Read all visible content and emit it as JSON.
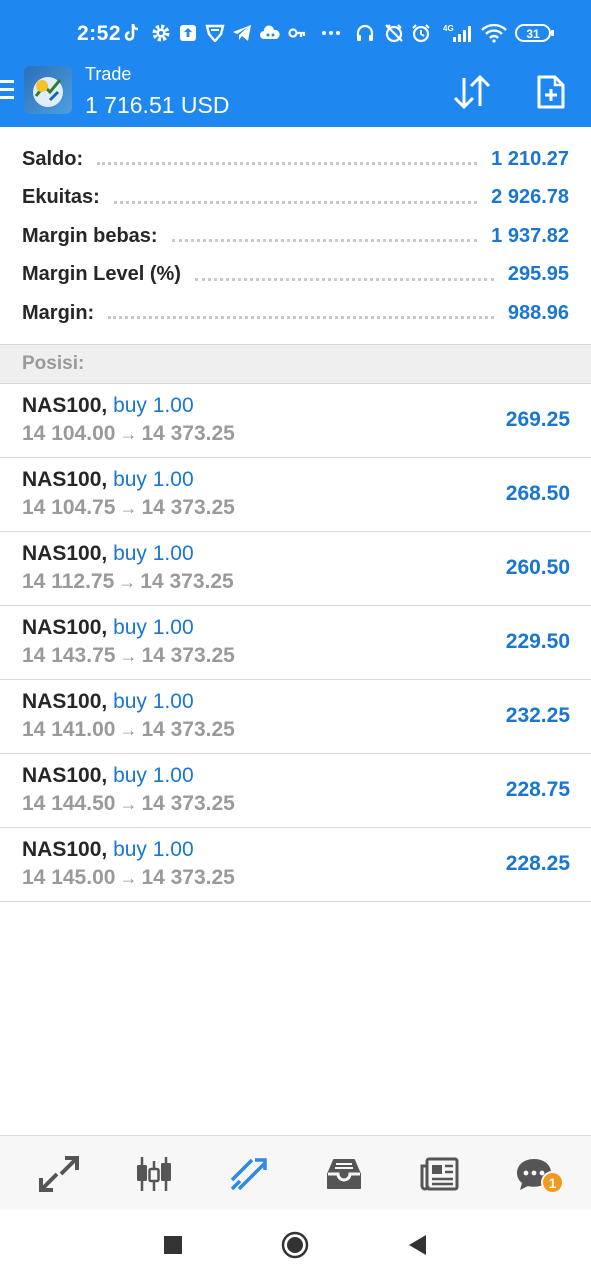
{
  "status_bar": {
    "time": "2:52",
    "network": "4G",
    "battery": "31"
  },
  "app_bar": {
    "title": "Trade",
    "balance": "1 716.51 USD"
  },
  "summary": [
    {
      "label": "Saldo:",
      "value": "1 210.27"
    },
    {
      "label": "Ekuitas:",
      "value": "2 926.78"
    },
    {
      "label": "Margin bebas:",
      "value": "1 937.82"
    },
    {
      "label": "Margin Level (%)",
      "value": "295.95"
    },
    {
      "label": "Margin:",
      "value": "988.96"
    }
  ],
  "section_label": "Posisi:",
  "positions": [
    {
      "symbol": "NAS100,",
      "side": "buy 1.00",
      "open": "14 104.00",
      "current": "14 373.25",
      "profit": "269.25"
    },
    {
      "symbol": "NAS100,",
      "side": "buy 1.00",
      "open": "14 104.75",
      "current": "14 373.25",
      "profit": "268.50"
    },
    {
      "symbol": "NAS100,",
      "side": "buy 1.00",
      "open": "14 112.75",
      "current": "14 373.25",
      "profit": "260.50"
    },
    {
      "symbol": "NAS100,",
      "side": "buy 1.00",
      "open": "14 143.75",
      "current": "14 373.25",
      "profit": "229.50"
    },
    {
      "symbol": "NAS100,",
      "side": "buy 1.00",
      "open": "14 141.00",
      "current": "14 373.25",
      "profit": "232.25"
    },
    {
      "symbol": "NAS100,",
      "side": "buy 1.00",
      "open": "14 144.50",
      "current": "14 373.25",
      "profit": "228.75"
    },
    {
      "symbol": "NAS100,",
      "side": "buy 1.00",
      "open": "14 145.00",
      "current": "14 373.25",
      "profit": "228.25"
    }
  ],
  "tabs": [
    {
      "icon": "quotes-arrows-icon",
      "active": false
    },
    {
      "icon": "candlestick-chart-icon",
      "active": false
    },
    {
      "icon": "trade-trend-icon",
      "active": true
    },
    {
      "icon": "history-inbox-icon",
      "active": false
    },
    {
      "icon": "news-icon",
      "active": false
    },
    {
      "icon": "messages-chat-icon",
      "active": false,
      "badge": "1"
    }
  ],
  "colors": {
    "header_blue": "#1e88f0",
    "value_blue": "#1976d2",
    "badge_orange": "#f39a1e"
  }
}
